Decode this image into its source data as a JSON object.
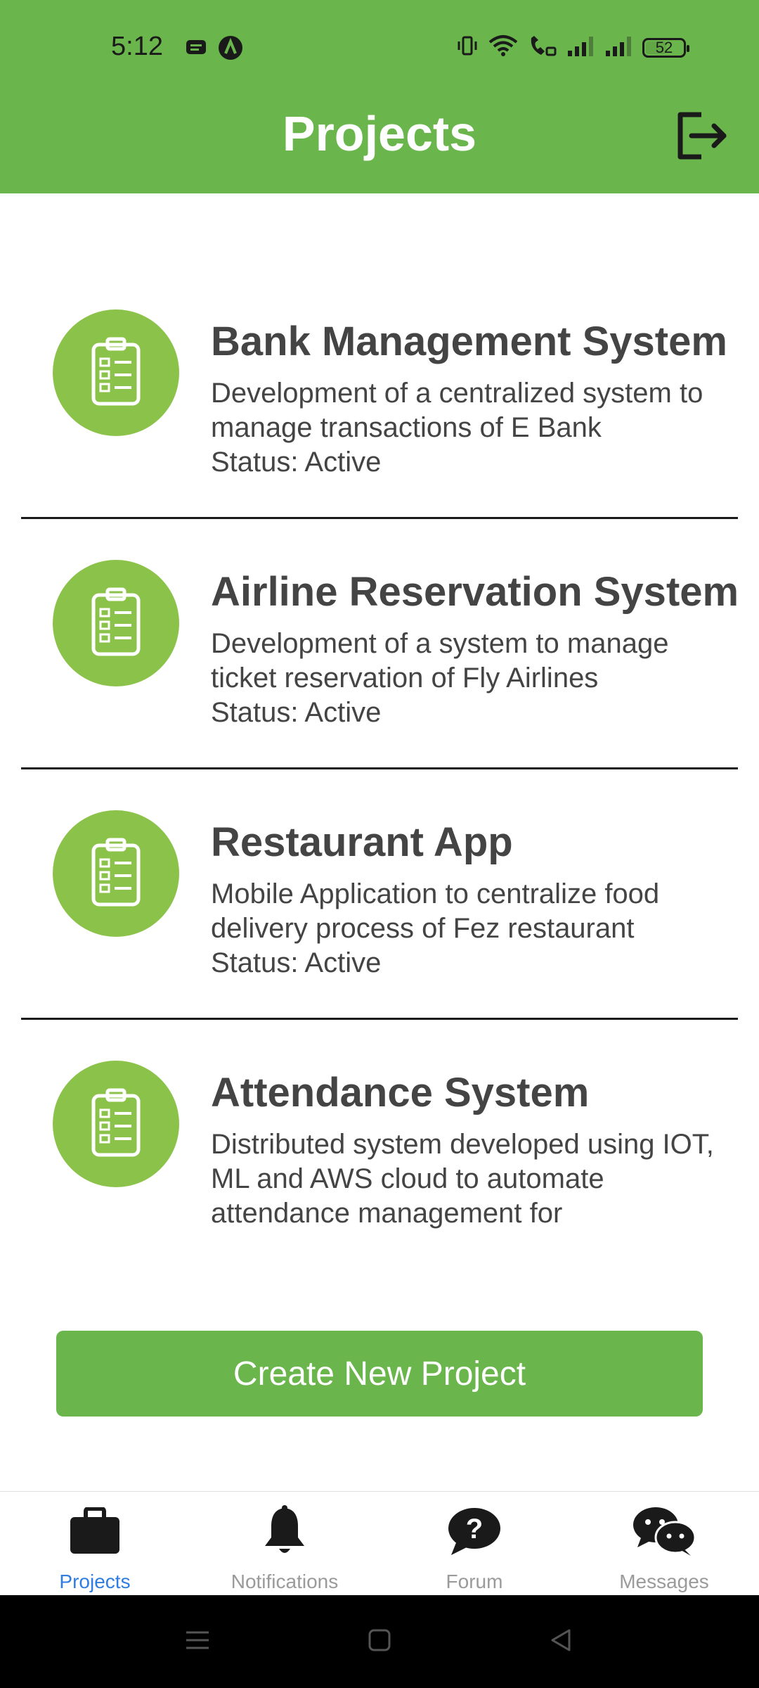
{
  "status_bar": {
    "time": "5:12",
    "battery": "52",
    "left_icons": [
      "notification-icon",
      "app-icon"
    ],
    "right_icons": [
      "vibrate-icon",
      "wifi-icon",
      "call-icon",
      "signal-icon",
      "signal-icon"
    ]
  },
  "header": {
    "title": "Projects",
    "logout_icon": "logout-icon"
  },
  "projects": [
    {
      "name": "Bank Management System",
      "description": "Development of a centralized system to manage transactions of E Bank",
      "status": "Status: Active"
    },
    {
      "name": "Airline Reservation System",
      "description": "Development of a system to manage ticket reservation of Fly Airlines",
      "status": "Status: Active"
    },
    {
      "name": "Restaurant App",
      "description": "Mobile Application to centralize food delivery process of Fez restaurant",
      "status": "Status: Active"
    },
    {
      "name": "Attendance System",
      "description": "Distributed system developed using IOT, ML and AWS cloud to automate attendance management for",
      "status": ""
    }
  ],
  "create_button": {
    "label": "Create New Project"
  },
  "tabs": [
    {
      "label": "Projects",
      "icon": "briefcase-icon",
      "active": true
    },
    {
      "label": "Notifications",
      "icon": "bell-icon",
      "active": false
    },
    {
      "label": "Forum",
      "icon": "question-bubble-icon",
      "active": false
    },
    {
      "label": "Messages",
      "icon": "chat-icon",
      "active": false
    }
  ],
  "colors": {
    "header": "#6ab64c",
    "avatar": "#8bc34a",
    "tab_active": "#2f7de1",
    "tab_inactive": "#9a9a9a"
  }
}
